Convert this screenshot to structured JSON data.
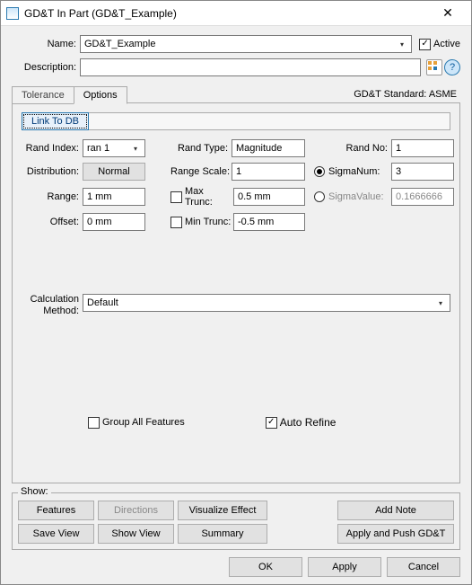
{
  "window": {
    "title": "GD&T In Part (GD&T_Example)"
  },
  "header": {
    "name_label": "Name:",
    "name_value": "GD&T_Example",
    "active_label": "Active",
    "active_checked": true,
    "desc_label": "Description:",
    "desc_value": ""
  },
  "tabs": {
    "tolerance": "Tolerance",
    "options": "Options",
    "gdt_standard": "GD&T Standard: ASME"
  },
  "options": {
    "link_btn": "Link To DB",
    "rand_index_label": "Rand Index:",
    "rand_index_value": "ran 1",
    "rand_type_label": "Rand Type:",
    "rand_type_value": "Magnitude",
    "rand_no_label": "Rand No:",
    "rand_no_value": "1",
    "distribution_label": "Distribution:",
    "distribution_value": "Normal",
    "range_scale_label": "Range Scale:",
    "range_scale_value": "1",
    "sigmanum_label": "SigmaNum:",
    "sigmanum_value": "3",
    "range_label": "Range:",
    "range_value": "1 mm",
    "max_trunc_label": "Max Trunc:",
    "max_trunc_value": "0.5 mm",
    "sigmavalue_label": "SigmaValue:",
    "sigmavalue_value": "0.1666666",
    "offset_label": "Offset:",
    "offset_value": "0 mm",
    "min_trunc_label": "Min Trunc:",
    "min_trunc_value": "-0.5 mm",
    "calc_method_label": "Calculation Method:",
    "calc_method_value": "Default",
    "group_all_label": "Group All Features",
    "auto_refine_label": "Auto Refine"
  },
  "show": {
    "legend": "Show:",
    "features": "Features",
    "directions": "Directions",
    "visualize": "Visualize Effect",
    "add_note": "Add Note",
    "save_view": "Save View",
    "show_view": "Show View",
    "summary": "Summary",
    "apply_push": "Apply and Push GD&T"
  },
  "dialog": {
    "ok": "OK",
    "apply": "Apply",
    "cancel": "Cancel"
  }
}
